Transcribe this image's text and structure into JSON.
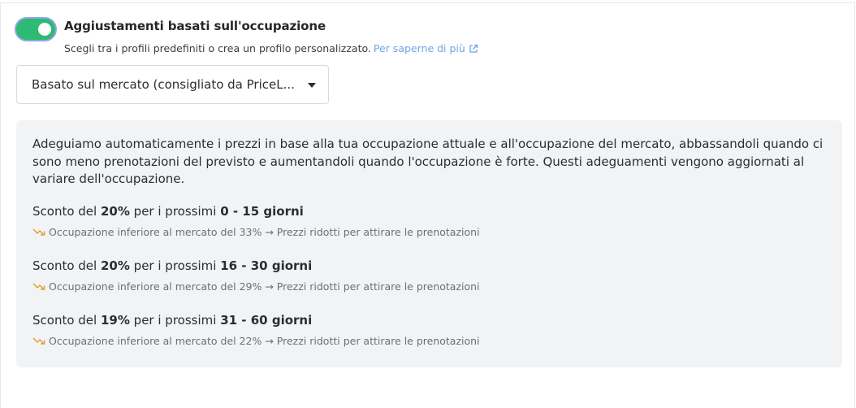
{
  "toggle": {
    "on": true
  },
  "header": {
    "title": "Aggiustamenti basati sull'occupazione",
    "subtitle": "Scegli tra i profili predefiniti o crea un profilo personalizzato.",
    "learn_more": "Per saperne di più"
  },
  "profile_select": {
    "value": "Basato sul mercato (consigliato da PriceL..."
  },
  "panel": {
    "description": "Adeguiamo automaticamente i prezzi in base alla tua occupazione attuale e all'occupazione del mercato, abbassandoli quando ci sono meno prenotazioni del previsto e aumentandoli quando l'occupazione è forte. Questi adeguamenti vengono aggiornati al variare dell'occupazione.",
    "tiers": [
      {
        "prefix": "Sconto del",
        "percent": "20%",
        "middle": "per i prossimi",
        "range": "0 - 15 giorni",
        "note": "Occupazione inferiore al mercato del 33% → Prezzi ridotti per attirare le prenotazioni"
      },
      {
        "prefix": "Sconto del",
        "percent": "20%",
        "middle": "per i prossimi",
        "range": "16 - 30 giorni",
        "note": "Occupazione inferiore al mercato del 29% → Prezzi ridotti per attirare le prenotazioni"
      },
      {
        "prefix": "Sconto del",
        "percent": "19%",
        "middle": "per i prossimi",
        "range": "31 - 60 giorni",
        "note": "Occupazione inferiore al mercato del 22% → Prezzi ridotti per attirare le prenotazioni"
      }
    ]
  },
  "colors": {
    "toggle_on": "#2dbb73",
    "link": "#6fa6e6",
    "trend_icon": "#e0a030",
    "panel_bg": "#f2f3f5"
  },
  "icons": {
    "external": "external-link-icon",
    "trend": "trending-down-icon",
    "caret": "caret-down-icon"
  }
}
